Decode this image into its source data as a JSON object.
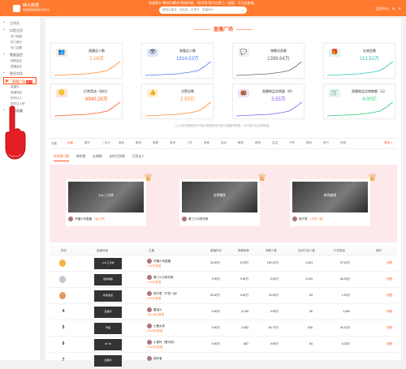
{
  "notice": "年度双11“影响力模式”系统升级，“轻识别”助力以更上一层楼，可点击查看。",
  "brand": {
    "name": "蝉大数据",
    "tagline": "短视频直播数据分析平台"
  },
  "search": {
    "placeholder": "搜索主播名、商品名、抖音号、直播间ID"
  },
  "user": {
    "items": [
      "会员中心",
      "✉",
      "☰"
    ]
  },
  "sidebar": {
    "items": [
      {
        "label": "工作台",
        "icon": "home-icon"
      },
      {
        "label": "抖音主页",
        "icon": "user-icon"
      },
      {
        "label": "热门视频",
        "sub": true
      },
      {
        "label": "热门音乐",
        "sub": true
      },
      {
        "label": "热门话题",
        "sub": true
      },
      {
        "label": "数据监控",
        "icon": "chart-icon"
      },
      {
        "label": "视频监控",
        "sub": true
      },
      {
        "label": "直播监控",
        "sub": true
      },
      {
        "label": "账号对比",
        "icon": "compare-icon"
      }
    ],
    "active": {
      "label": "直播广场",
      "hot": "HOT"
    },
    "after": [
      {
        "label": "直播号",
        "sub": true
      },
      {
        "label": "直播商品",
        "sub": true
      },
      {
        "label": "带货达人",
        "sub": true
      },
      {
        "label": "带货达人榜",
        "sub": true
      },
      {
        "label": "我的收藏",
        "icon": "star-icon"
      }
    ]
  },
  "plaza": {
    "title": "直播广场"
  },
  "stats": [
    {
      "label": "直播总人数",
      "value": "2.16万",
      "color": "#ff8a2a",
      "icon": "group-icon",
      "glyph": "👥",
      "bg": "#ffe9d6"
    },
    {
      "label": "观看总人数",
      "value": "1814.53万",
      "color": "#4a7cf0",
      "icon": "eye-icon",
      "glyph": "👁",
      "bg": "#dfe8ff"
    },
    {
      "label": "弹幕总条数",
      "value": "1398.64万",
      "color": "#666666",
      "icon": "message-icon",
      "glyph": "💬",
      "bg": "#eeeeee"
    },
    {
      "label": "礼物总数",
      "value": "113.52万",
      "color": "#2ec4b6",
      "icon": "gift-icon",
      "glyph": "🎁",
      "bg": "#dcf6f3"
    },
    {
      "label": "打赏音浪（场均）",
      "value": "8940.26万",
      "color": "#ff5a1f",
      "icon": "coin-icon",
      "glyph": "🪙",
      "bg": "#ffe3d6"
    },
    {
      "label": "点赞总数",
      "value": "2.55亿",
      "color": "#ff8a2a",
      "icon": "thumb-icon",
      "glyph": "👍",
      "bg": "#fff0d6"
    },
    {
      "label": "直播商品总销量（件）",
      "value": "3.55万",
      "color": "#8a5cf0",
      "icon": "bag-icon",
      "glyph": "👜",
      "bg": "#ece4ff"
    },
    {
      "label": "直播商品总销售额（元）",
      "value": "4.00亿",
      "color": "#2ecc71",
      "icon": "cart-icon",
      "glyph": "🛒",
      "bg": "#dff7e9"
    }
  ],
  "note": "以上统计数据仅用于蝉大数据收录的部分直播间数据，不代表平台全部数据。",
  "filter": {
    "label": "分类",
    "chips": [
      "全部",
      "娱乐",
      "二次元",
      "美妆",
      "服饰",
      "母婴",
      "游戏",
      "三农",
      "美食",
      "运动",
      "萌宠",
      "教育",
      "生活",
      "汽车",
      "数码",
      "旅行",
      "其他"
    ],
    "more": "更多 ▾"
  },
  "rank_tabs": [
    "实时热门榜",
    "带货榜",
    "礼物榜",
    "实时打赏榜",
    "打赏达人"
  ],
  "podium": [
    {
      "name": "1v8 三分钟",
      "anchor": "开播小号直播",
      "tag": "（仙人掌）"
    },
    {
      "name": "金牌捕鱼",
      "anchor": "第三小分带货家",
      "tag": ""
    },
    {
      "name": "新闻速递",
      "anchor": "柚子君",
      "tag": "（子悦一起）"
    }
  ],
  "table": {
    "headers": [
      "排名",
      "直播封面",
      "主播",
      "直播时长",
      "弹幕条数",
      "观看人数",
      "实时打赏人数",
      "打赏音浪",
      "操作"
    ],
    "rows": [
      {
        "rank": "1",
        "cover": "1v8 三分钟",
        "anchor": "开播小号直播",
        "sales": "2.52万音浪",
        "duration": "16.00万",
        "comments": "5.23万",
        "viewers": "100.00万",
        "tippers": "2,824",
        "coins": "37.02万"
      },
      {
        "rank": "2",
        "cover": "金牌捕鱼",
        "anchor": "第三小分带货家",
        "sales": "1.13万音浪",
        "duration": "9.90万",
        "comments": "9.90万",
        "viewers": "9.90万",
        "tippers": "2,429",
        "coins": "46.93万"
      },
      {
        "rank": "3",
        "cover": "新闻速递",
        "anchor": "柚子君（子悦一起）",
        "sales": "9.50万音浪",
        "duration": "16.00万",
        "comments": "9.90万",
        "viewers": "16.00万",
        "tippers": "84",
        "coins": "1.20万"
      },
      {
        "rank": "4",
        "cover": "直播间",
        "anchor": "雷诺么",
        "sales": "154.06万音浪",
        "duration": "9.90万",
        "comments": "6,248",
        "viewers": "9.90万",
        "tippers": "96",
        "coins": "1,069"
      },
      {
        "rank": "5",
        "cover": "开播",
        "anchor": "小鹿女孩",
        "sales": "15.66万音浪",
        "duration": "9.90万",
        "comments": "2,582",
        "viewers": "63.72万",
        "tippers": "825",
        "coins": "26.10万"
      },
      {
        "rank": "6",
        "cover": "PK 中",
        "anchor": "小檬好（曹可欣）",
        "sales": "15.66万音浪",
        "duration": "9.90万",
        "comments": "887",
        "viewers": "9.90万",
        "tippers": "84",
        "coins": "6.33万"
      },
      {
        "rank": "7",
        "cover": "直播中",
        "anchor": "陪伴者",
        "sales": "",
        "duration": "",
        "comments": "",
        "viewers": "",
        "tippers": "",
        "coins": ""
      }
    ],
    "op_label": "查看"
  }
}
